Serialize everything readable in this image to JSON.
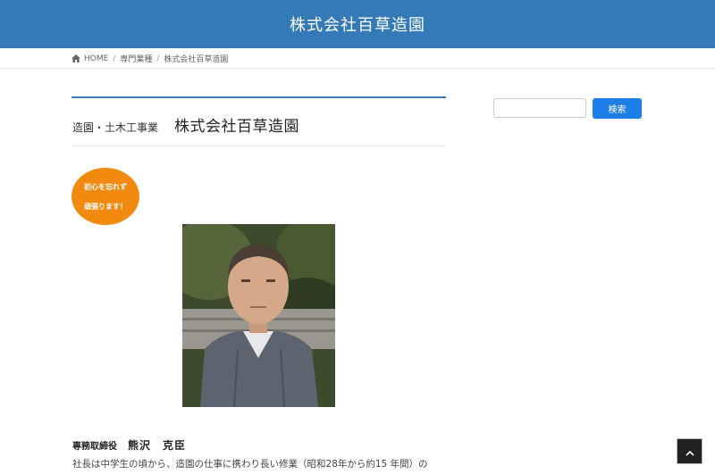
{
  "site": {
    "title": "株式会社百草造園"
  },
  "breadcrumb": {
    "home_icon": "home-icon",
    "home_label": "HOME",
    "items": [
      "専門業種",
      "株式会社百草造園"
    ],
    "separator": "/"
  },
  "article": {
    "category": "造園・土木工事業",
    "company": "株式会社百草造園",
    "badge_lines": [
      "初心を忘れず",
      "頑張ります！"
    ],
    "role": "専務取締役",
    "person": "熊沢　克臣",
    "bio": "社長は中学生の頃から、造園の仕事に携わり長い修業（昭和28年から約15 年間）の"
  },
  "sidebar": {
    "search_placeholder": "",
    "search_button": "検索"
  },
  "colors": {
    "header": "#337ab7",
    "badge": "#f28a0f",
    "search_button": "#1e7ee8"
  },
  "scroll_top_icon": "chevron-up-icon"
}
